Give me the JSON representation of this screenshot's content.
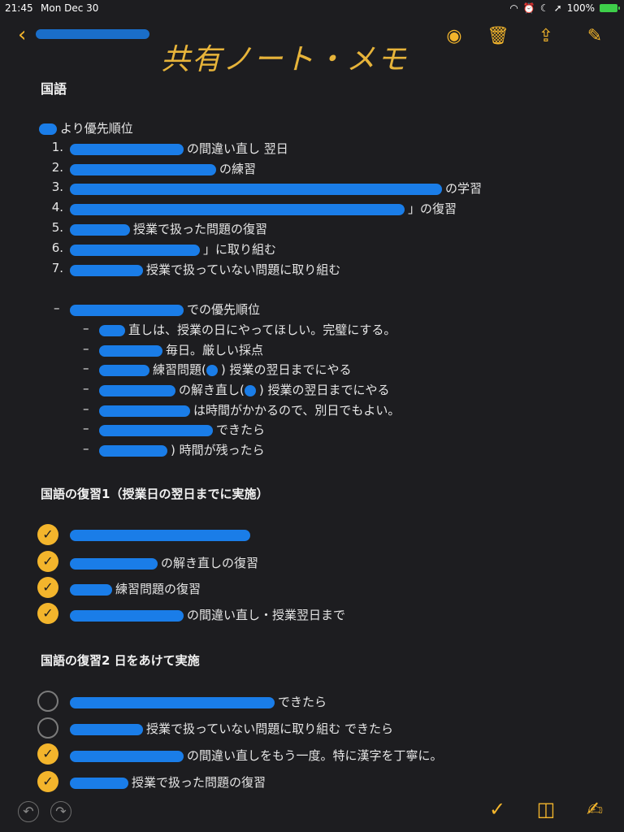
{
  "status_bar": {
    "time": "21:45",
    "date": "Mon Dec 30",
    "battery": "100%"
  },
  "toolbar": {
    "handwritten_title": "共有ノート・メモ",
    "icons": [
      "person-badge-icon",
      "trash-icon",
      "share-icon",
      "compose-icon"
    ]
  },
  "note": {
    "title": "国語",
    "priority_intro": "より優先順位",
    "priority_list": [
      {
        "num": "1.",
        "text": "の間違い直し 翌日"
      },
      {
        "num": "2.",
        "text": "の練習"
      },
      {
        "num": "3.",
        "text": "の学習"
      },
      {
        "num": "4.",
        "text": "」の復習"
      },
      {
        "num": "5.",
        "text": "授業で扱った問題の復習"
      },
      {
        "num": "6.",
        "text": "」に取り組む"
      },
      {
        "num": "7.",
        "text": "授業で扱っていない問題に取り組む"
      }
    ],
    "sub_heading": "での優先順位",
    "sub_items": [
      "直しは、授業の日にやってほしい。完璧にする。",
      "毎日。厳しい採点",
      "練習問題(",
      "の解き直し(",
      "は時間がかかるので、別日でもよい。",
      "できたら",
      ") 時間が残ったら"
    ],
    "sub_item_suffixes": {
      "item3": ") 授業の翌日までにやる",
      "item4": ") 授業の翌日までにやる"
    },
    "section1_title": "国語の復習1（授業日の翌日までに実施）",
    "section1_items": [
      {
        "checked": true,
        "text": ""
      },
      {
        "checked": true,
        "text": "の解き直しの復習"
      },
      {
        "checked": true,
        "text": "練習問題の復習"
      },
      {
        "checked": true,
        "text": "の間違い直し・授業翌日まで"
      }
    ],
    "section2_title": "国語の復習2 日をあけて実施",
    "section2_items": [
      {
        "checked": false,
        "text": "できたら"
      },
      {
        "checked": false,
        "text": "授業で扱っていない問題に取り組む できたら"
      },
      {
        "checked": true,
        "text": "の間違い直しをもう一度。特に漢字を丁寧に。"
      },
      {
        "checked": true,
        "text": "授業で扱った問題の復習"
      }
    ]
  },
  "colors": {
    "accent": "#f3b52c",
    "background": "#1d1d20",
    "redaction": "#1a7de8"
  }
}
